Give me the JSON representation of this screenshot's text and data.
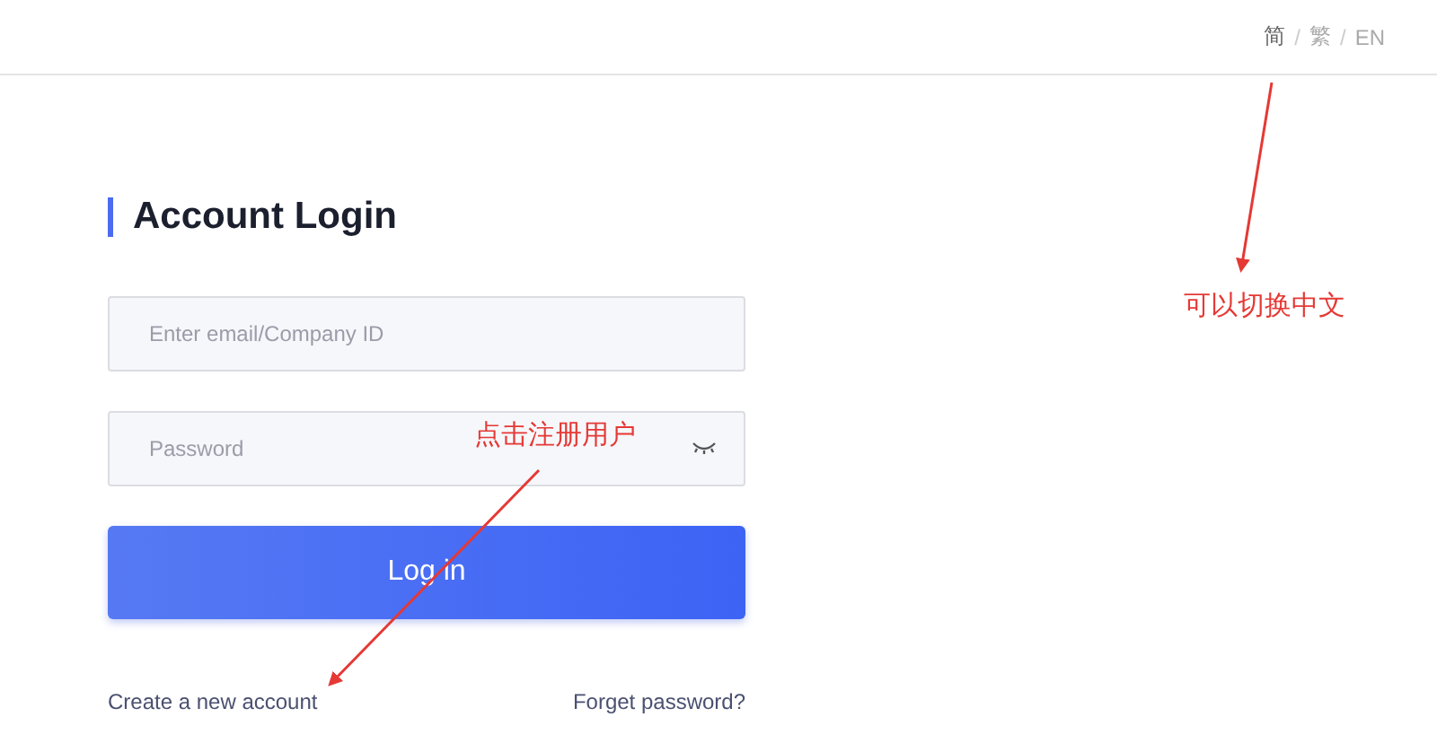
{
  "language_separator": "/",
  "languages": [
    {
      "label": "简",
      "selected": true
    },
    {
      "label": "繁",
      "selected": false
    },
    {
      "label": "EN",
      "selected": false
    }
  ],
  "login": {
    "title": "Account Login",
    "email": {
      "placeholder": "Enter email/Company ID"
    },
    "password": {
      "placeholder": "Password"
    },
    "submit": "Log in",
    "create_account": "Create a new account",
    "forgot_password": "Forget password?"
  },
  "annotations": [
    {
      "text": "可以切换中文"
    },
    {
      "text": "点击注册用户"
    }
  ]
}
